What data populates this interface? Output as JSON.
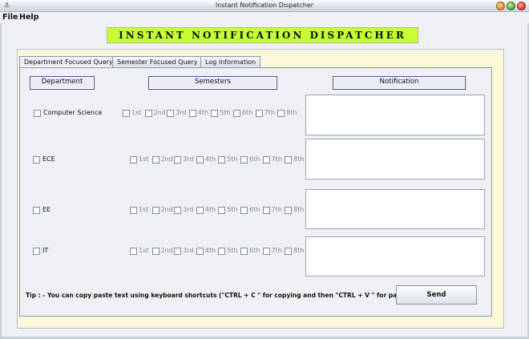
{
  "window": {
    "title": "Instant Notification Dispatcher"
  },
  "menu": {
    "items": [
      "File",
      "Help"
    ]
  },
  "banner": {
    "text": "INSTANT NOTIFICATION DISPATCHER",
    "color": "#c6ff33"
  },
  "tabs": [
    "Department Focused Query",
    "Semester Focused Query",
    "Log Information"
  ],
  "active_tab": "Department Focused Query",
  "headers": {
    "department": "Department",
    "semesters": "Semesters",
    "notification": "Notification"
  },
  "departments": [
    {
      "label": "Computer Science",
      "checked": false,
      "notification": ""
    },
    {
      "label": "ECE",
      "checked": false,
      "notification": ""
    },
    {
      "label": "EE",
      "checked": false,
      "notification": ""
    },
    {
      "label": "IT",
      "checked": false,
      "notification": ""
    }
  ],
  "semesters": [
    "1st",
    "2nd",
    "3rd",
    "4th",
    "5th",
    "6th",
    "7th",
    "8th"
  ],
  "tip": "Tip : - You can copy paste text using keyboard shortcuts (\"CTRL + C \" for copying and then \"CTRL + V \" for pasting ...",
  "send_label": "Send"
}
